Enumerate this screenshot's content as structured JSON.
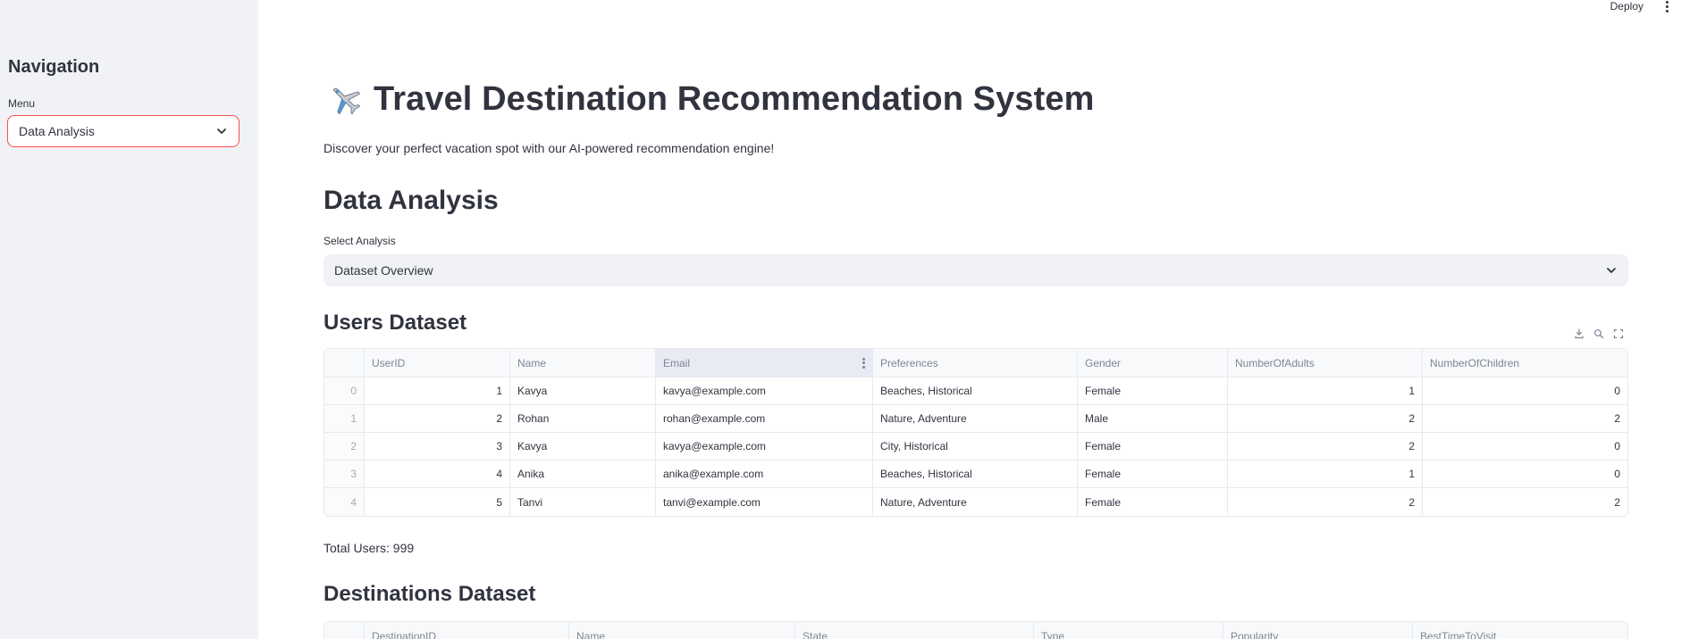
{
  "sidebar": {
    "title": "Navigation",
    "menu_label": "Menu",
    "menu_value": "Data Analysis"
  },
  "topbar": {
    "deploy_label": "Deploy"
  },
  "main": {
    "title": "Travel Destination Recommendation System",
    "title_icon": "airplane-icon",
    "tagline": "Discover your perfect vacation spot with our AI-powered recommendation engine!",
    "section_title": "Data Analysis",
    "analysis_label": "Select Analysis",
    "analysis_value": "Dataset Overview"
  },
  "users": {
    "title": "Users Dataset",
    "columns": [
      "UserID",
      "Name",
      "Email",
      "Preferences",
      "Gender",
      "NumberOfAdults",
      "NumberOfChildren"
    ],
    "rows": [
      {
        "idx": "0",
        "id": "1",
        "name": "Kavya",
        "email": "kavya@example.com",
        "prefs": "Beaches, Historical",
        "gender": "Female",
        "adults": "1",
        "children": "0"
      },
      {
        "idx": "1",
        "id": "2",
        "name": "Rohan",
        "email": "rohan@example.com",
        "prefs": "Nature, Adventure",
        "gender": "Male",
        "adults": "2",
        "children": "2"
      },
      {
        "idx": "2",
        "id": "3",
        "name": "Kavya",
        "email": "kavya@example.com",
        "prefs": "City, Historical",
        "gender": "Female",
        "adults": "2",
        "children": "0"
      },
      {
        "idx": "3",
        "id": "4",
        "name": "Anika",
        "email": "anika@example.com",
        "prefs": "Beaches, Historical",
        "gender": "Female",
        "adults": "1",
        "children": "0"
      },
      {
        "idx": "4",
        "id": "5",
        "name": "Tanvi",
        "email": "tanvi@example.com",
        "prefs": "Nature, Adventure",
        "gender": "Female",
        "adults": "2",
        "children": "2"
      }
    ],
    "total": "Total Users: 999"
  },
  "destinations": {
    "title": "Destinations Dataset",
    "columns": [
      "DestinationID",
      "Name",
      "State",
      "Type",
      "Popularity",
      "BestTimeToVisit"
    ]
  },
  "colors": {
    "accent": "#ff4b4b",
    "sidebar_bg": "#f0f2f6",
    "text": "#31333f",
    "muted": "#808495"
  }
}
